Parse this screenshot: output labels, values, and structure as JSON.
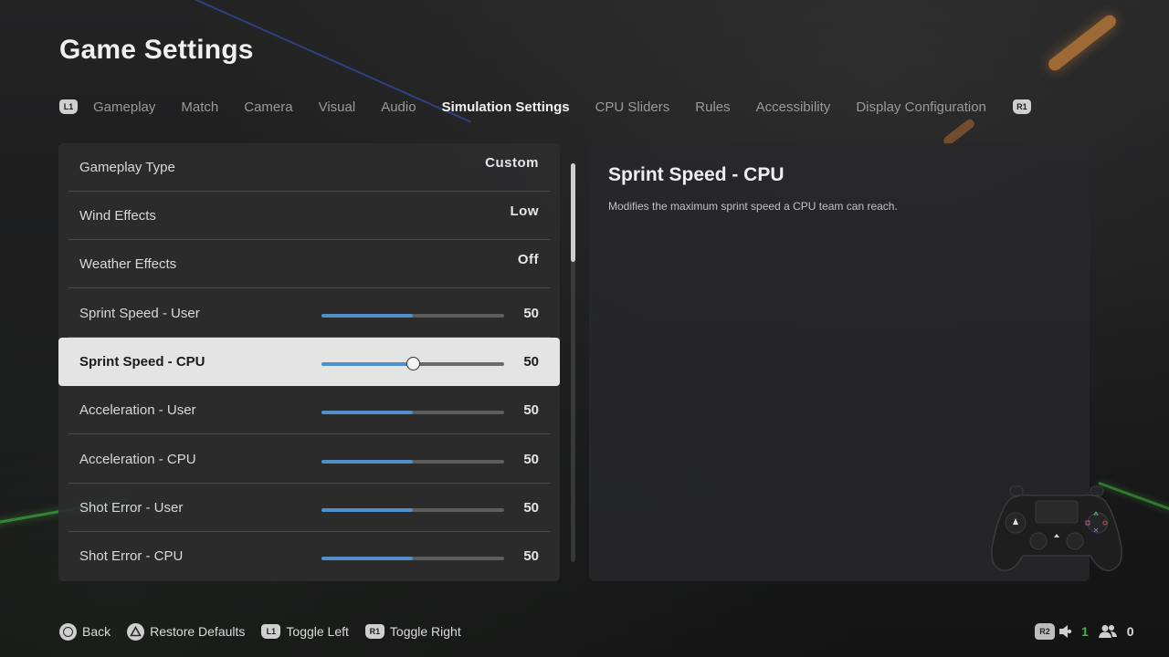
{
  "page_title": "Game Settings",
  "tabs": {
    "left_bumper": "L1",
    "right_bumper": "R1",
    "items": [
      {
        "label": "Gameplay"
      },
      {
        "label": "Match"
      },
      {
        "label": "Camera"
      },
      {
        "label": "Visual"
      },
      {
        "label": "Audio"
      },
      {
        "label": "Simulation Settings",
        "active": true
      },
      {
        "label": "CPU Sliders"
      },
      {
        "label": "Rules"
      },
      {
        "label": "Accessibility"
      },
      {
        "label": "Display Configuration"
      }
    ]
  },
  "settings": [
    {
      "label": "Gameplay Type",
      "type": "option",
      "value": "Custom"
    },
    {
      "label": "Wind Effects",
      "type": "option",
      "value": "Low"
    },
    {
      "label": "Weather Effects",
      "type": "option",
      "value": "Off"
    },
    {
      "label": "Sprint Speed - User",
      "type": "slider",
      "value": "50",
      "fraction": 0.5
    },
    {
      "label": "Sprint Speed - CPU",
      "type": "slider",
      "value": "50",
      "fraction": 0.5,
      "selected": true
    },
    {
      "label": "Acceleration - User",
      "type": "slider",
      "value": "50",
      "fraction": 0.5
    },
    {
      "label": "Acceleration - CPU",
      "type": "slider",
      "value": "50",
      "fraction": 0.5
    },
    {
      "label": "Shot Error - User",
      "type": "slider",
      "value": "50",
      "fraction": 0.5
    },
    {
      "label": "Shot Error - CPU",
      "type": "slider",
      "value": "50",
      "fraction": 0.5
    }
  ],
  "description": {
    "title": "Sprint Speed - CPU",
    "text": "Modifies the maximum sprint speed a CPU team can reach.",
    "controller_icon": "gamepad-icon"
  },
  "footer": {
    "back": {
      "icon": "circle-button-icon",
      "label": "Back"
    },
    "restore": {
      "icon": "triangle-button-icon",
      "label": "Restore Defaults"
    },
    "toggle_left": {
      "icon": "L1",
      "label": "Toggle Left"
    },
    "toggle_right": {
      "icon": "R1",
      "label": "Toggle Right"
    }
  },
  "status": {
    "r2": "R2",
    "voice_count": "1",
    "party_count": "0",
    "voice_icon": "speaker-icon",
    "party_icon": "party-icon"
  },
  "colors": {
    "slider_fill": "#4f8fca",
    "selected_row": "#e4e4e4",
    "voice_green": "#4caf50"
  }
}
